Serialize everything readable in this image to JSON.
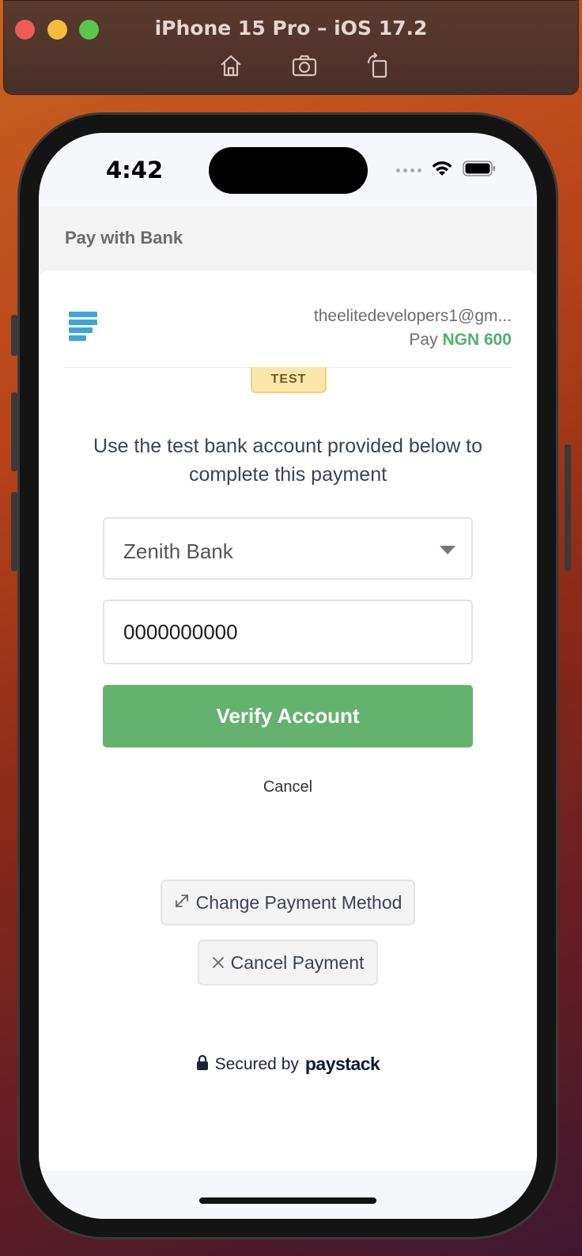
{
  "simulator": {
    "title": "iPhone 15 Pro – iOS 17.2",
    "tools": [
      "home-icon",
      "screenshot-icon",
      "rotate-icon"
    ]
  },
  "status_bar": {
    "time": "4:42"
  },
  "header": {
    "title": "Pay with Bank"
  },
  "merchant": {
    "email": "theelitedevelopers1@gm...",
    "pay_label": "Pay",
    "amount": "NGN 600"
  },
  "badge": "TEST",
  "instruction": "Use the test bank account provided below to complete this payment",
  "form": {
    "bank": "Zenith Bank",
    "account_number": "0000000000",
    "verify_label": "Verify Account",
    "cancel_label": "Cancel"
  },
  "actions": {
    "change_method": "Change Payment Method",
    "cancel_payment": "Cancel Payment"
  },
  "footer": {
    "secured_by": "Secured by",
    "brand": "paystack"
  },
  "colors": {
    "accent_green": "#65b26e",
    "amount_green": "#4db26a",
    "logo_blue": "#3fa4d8"
  }
}
